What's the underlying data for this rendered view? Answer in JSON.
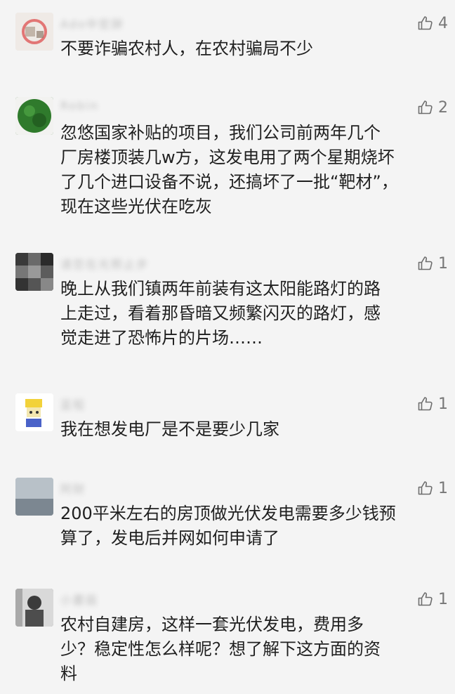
{
  "comments": [
    {
      "name": "Ado中宏辞",
      "likes": "4",
      "lines": "不要诈骗农村人，在农村骗局不少"
    },
    {
      "name": "Robin",
      "likes": "2",
      "lines": "忽悠国家补贴的项目，我们公司前两年几个\n厂房楼顶装几w方，这发电用了两个星期烧坏\n了几个进口设备不说，还搞坏了一批“靶材”，\n现在这些光伏在吃灰"
    },
    {
      "name": "请您在光照止步",
      "likes": "1",
      "lines": "晚上从我们镇两年前装有这太阳能路灯的路\n上走过，看着那昏暗又频繁闪灭的路灯，感\n觉走进了恐怖片的片场……"
    },
    {
      "name": "蓝程",
      "likes": "1",
      "lines": "我在想发电厂是不是要少几家"
    },
    {
      "name": "阿财",
      "likes": "1",
      "lines": "200平米左右的房顶做光伏发电需要多少钱预\n算了，发电后并网如何申请了"
    },
    {
      "name": "小蘑菇",
      "likes": "1",
      "lines": "农村自建房，这样一套光伏发电，费用多\n少？稳定性怎么样呢？想了解下这方面的资\n料"
    }
  ]
}
